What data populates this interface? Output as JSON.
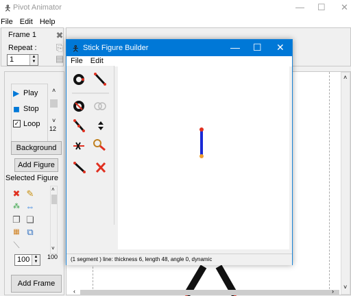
{
  "main": {
    "title": "Pivot Animator",
    "menu": [
      "File",
      "Edit",
      "Help"
    ],
    "frame_panel": {
      "frame_label": "Frame 1",
      "repeat_label": "Repeat :",
      "repeat_value": "1"
    },
    "controls": {
      "play_label": "Play",
      "stop_label": "Stop",
      "loop_label": "Loop",
      "speed_value": "12",
      "background_button": "Background",
      "add_figure_button": "Add Figure",
      "selected_figure_label": "Selected Figure",
      "scale_value": "100",
      "scale_max": "100",
      "add_frame_button": "Add Frame"
    },
    "window_controls": {
      "minimize": "—",
      "maximize": "☐",
      "close": "✕"
    }
  },
  "dialog": {
    "title": "Stick Figure Builder",
    "menu": [
      "File",
      "Edit"
    ],
    "status_text": "(1 segment )   line: thickness 6, length 48, angle 0, dynamic",
    "window_controls": {
      "minimize": "—",
      "maximize": "☐",
      "close": "✕"
    }
  },
  "colors": {
    "accent": "#0078d7",
    "segment": "#1a2ad6",
    "joint": "#e03020",
    "handle": "#f0a030"
  }
}
